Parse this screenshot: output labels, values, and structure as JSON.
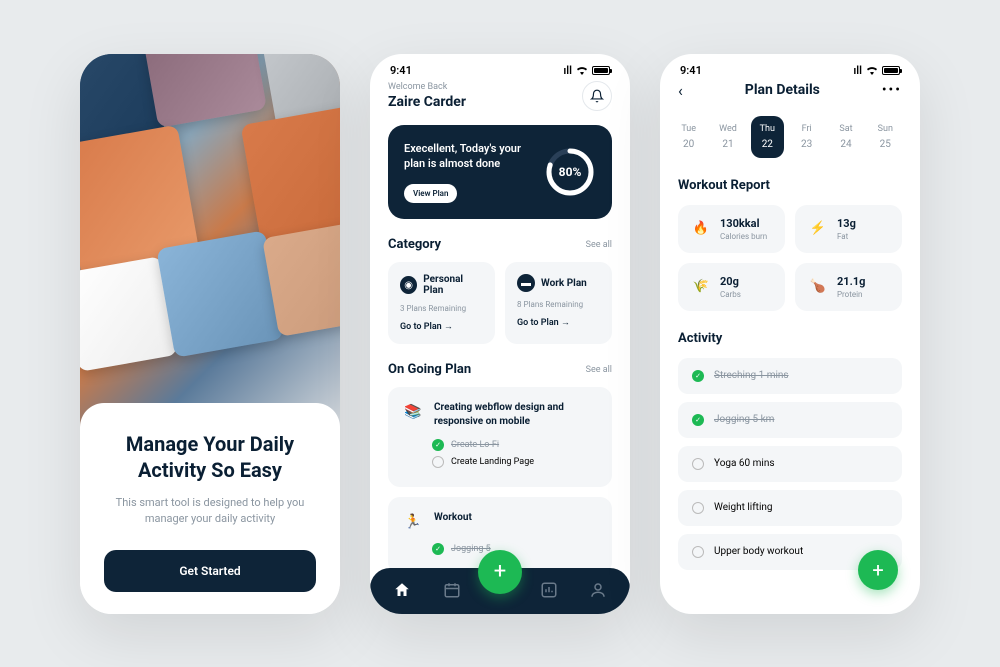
{
  "status_time": "9:41",
  "onboarding": {
    "title": "Manage Your Daily Activity So Easy",
    "subtitle": "This smart tool is designed to help you manager your daily activity",
    "cta": "Get Started"
  },
  "home": {
    "welcome": "Welcome Back",
    "username": "Zaire Carder",
    "progress": {
      "text": "Execellent, Today's your plan is almost done",
      "button": "View Plan",
      "percent": "80%"
    },
    "category": {
      "title": "Category",
      "see_all": "See all",
      "personal": {
        "name": "Personal Plan",
        "sub": "3 Plans Remaining",
        "link": "Go to Plan  →"
      },
      "work": {
        "name": "Work Plan",
        "sub": "8 Plans Remaining",
        "link": "Go to Plan  →"
      }
    },
    "ongoing": {
      "title": "On Going Plan",
      "see_all": "See all",
      "plan1": {
        "title": "Creating webflow design and responsive on mobile",
        "task1": "Create Lo-Fi",
        "task2": "Create Landing Page"
      },
      "plan2": {
        "title": "Workout",
        "task1": "Jogging 5"
      }
    }
  },
  "details": {
    "title": "Plan Details",
    "days": [
      {
        "name": "Tue",
        "num": "20"
      },
      {
        "name": "Wed",
        "num": "21"
      },
      {
        "name": "Thu",
        "num": "22"
      },
      {
        "name": "Fri",
        "num": "23"
      },
      {
        "name": "Sat",
        "num": "24"
      },
      {
        "name": "Sun",
        "num": "25"
      }
    ],
    "report": {
      "title": "Workout Report",
      "calories": {
        "val": "130kkal",
        "label": "Calories burn"
      },
      "fat": {
        "val": "13g",
        "label": "Fat"
      },
      "carbs": {
        "val": "20g",
        "label": "Carbs"
      },
      "protein": {
        "val": "21.1g",
        "label": "Protein"
      }
    },
    "activity": {
      "title": "Activity",
      "items": [
        "Streching 1 mins",
        "Jogging 5 km",
        "Yoga 60 mins",
        "Weight lifting",
        "Upper body workout"
      ]
    }
  }
}
